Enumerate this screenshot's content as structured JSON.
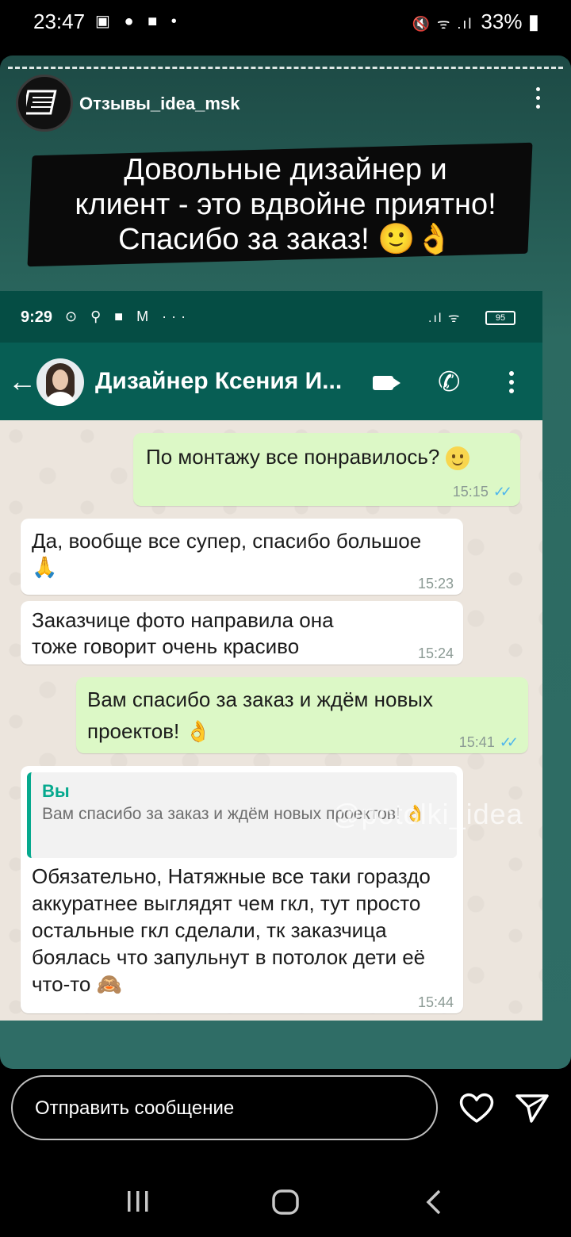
{
  "status_bar": {
    "time": "23:47",
    "battery": "33%"
  },
  "story": {
    "username": "Отзывы_idea_msk",
    "headline_lines": [
      "Довольные дизайнер и",
      "клиент - это вдвойне приятно!",
      "Спасибо за заказ! 🙂👌"
    ]
  },
  "whatsapp": {
    "status_time": "9:29",
    "battery": "95",
    "contact_name": "Дизайнер Ксения И...",
    "messages": [
      {
        "direction": "out",
        "text": "По монтажу все понравилось?",
        "time": "15:15"
      },
      {
        "direction": "in",
        "text": "Да, вообще все супер, спасибо большое 🙏",
        "time": "15:23"
      },
      {
        "direction": "in",
        "text": "Заказчице фото направила она тоже говорит очень красиво",
        "time": "15:24"
      },
      {
        "direction": "out",
        "text": "Вам спасибо за заказ и ждём новых проектов! 👌",
        "time": "15:41"
      },
      {
        "direction": "in",
        "reply_name": "Вы",
        "reply_text": "Вам спасибо за заказ и ждём новых проектов! 👌",
        "text": "Обязательно, Натяжные все таки гораздо аккуратнее выглядят чем гкл, тут просто остальные гкл сделали, тк заказчица боялась что запульнут в потолок дети её что-то 🙈",
        "time": "15:44"
      }
    ],
    "watermark": "@potolki_idea"
  },
  "bottom": {
    "message_placeholder": "Отправить сообщение"
  }
}
